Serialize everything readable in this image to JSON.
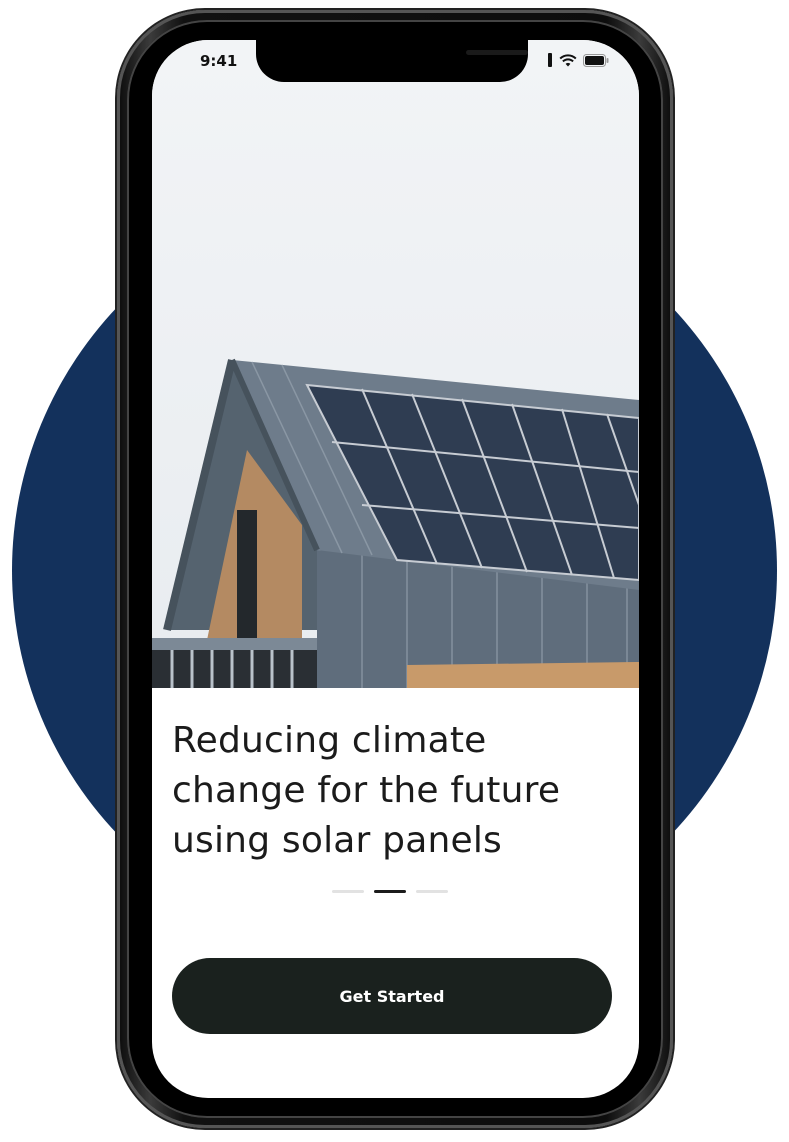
{
  "status_bar": {
    "time": "9:41",
    "signal_icon": "signal-bars-icon",
    "wifi_icon": "wifi-icon",
    "battery_icon": "battery-icon"
  },
  "hero": {
    "image_description_icon": "house-with-solar-panels-image"
  },
  "onboarding": {
    "headline": "Reducing climate change for the future using solar panels",
    "pager": {
      "total": 3,
      "active_index": 1
    },
    "cta_label": "Get Started"
  },
  "colors": {
    "background_circle": "#13315c",
    "button_bg": "#1a211e",
    "button_text": "#ffffff",
    "headline_text": "#1b1b1b",
    "pager_active": "#1b1b1b",
    "pager_inactive": "#e2e2e2"
  }
}
